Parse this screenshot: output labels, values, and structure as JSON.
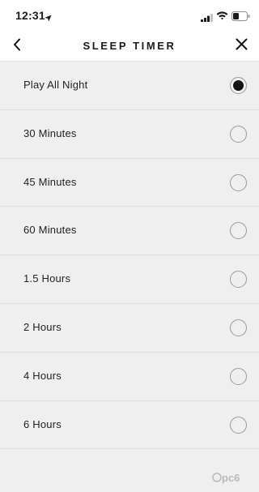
{
  "status_bar": {
    "time": "12:31"
  },
  "header": {
    "title": "SLEEP TIMER"
  },
  "options": [
    {
      "label": "Play All Night",
      "selected": true
    },
    {
      "label": "30 Minutes",
      "selected": false
    },
    {
      "label": "45 Minutes",
      "selected": false
    },
    {
      "label": "60 Minutes",
      "selected": false
    },
    {
      "label": "1.5 Hours",
      "selected": false
    },
    {
      "label": "2 Hours",
      "selected": false
    },
    {
      "label": "4 Hours",
      "selected": false
    },
    {
      "label": "6 Hours",
      "selected": false
    }
  ],
  "watermark": "pc6",
  "colors": {
    "background": "#efefef",
    "bar": "#ffffff",
    "text": "#1b1b1b",
    "radio_border": "#9a9a9a",
    "radio_fill": "#111111"
  },
  "icons": [
    "location-arrow-icon",
    "cellular-signal-icon",
    "wifi-icon",
    "battery-icon",
    "back-chevron-icon",
    "close-x-icon"
  ]
}
